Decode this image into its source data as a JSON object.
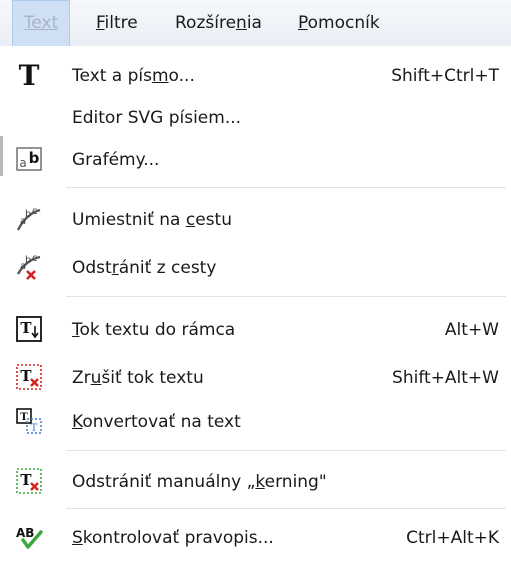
{
  "menubar": {
    "items": [
      {
        "label": "Text"
      },
      {
        "pre": "",
        "ul": "F",
        "post": "iltre"
      },
      {
        "label": "Rozšírenia"
      },
      {
        "pre": "",
        "ul": "P",
        "post": "omocník"
      }
    ]
  },
  "menu": {
    "items": [
      {
        "pre": "Text a pís",
        "ul": "m",
        "post": "o...",
        "shortcut": "Shift+Ctrl+T",
        "icon": "text-font-icon"
      },
      {
        "pre": "Editor SVG písiem...",
        "ul": "",
        "post": "",
        "shortcut": "",
        "icon": ""
      },
      {
        "pre": "Grafémy...",
        "ul": "",
        "post": "",
        "shortcut": "",
        "icon": "glyphs-icon"
      },
      {
        "pre": "Umiestniť na ",
        "ul": "c",
        "post": "estu",
        "shortcut": "",
        "icon": "put-on-path-icon"
      },
      {
        "pre": "Odst",
        "ul": "r",
        "post": "ániť z cesty",
        "shortcut": "",
        "icon": "remove-from-path-icon"
      },
      {
        "pre": "",
        "ul": "T",
        "post": "ok textu do rámca",
        "shortcut": "Alt+W",
        "icon": "flow-into-frame-icon"
      },
      {
        "pre": "Zr",
        "ul": "u",
        "post": "šiť tok textu",
        "shortcut": "Shift+Alt+W",
        "icon": "unflow-icon"
      },
      {
        "pre": "",
        "ul": "K",
        "post": "onvertovať na text",
        "shortcut": "",
        "icon": "convert-to-text-icon"
      },
      {
        "pre": "Odstrániť manuálny „",
        "ul": "k",
        "post": "erning\"",
        "shortcut": "",
        "icon": "remove-kerning-icon"
      },
      {
        "pre": "",
        "ul": "S",
        "post": "kontrolovať pravopis...",
        "shortcut": "Ctrl+Alt+K",
        "icon": "spellcheck-icon"
      }
    ]
  },
  "colors": {
    "menubar_active_bg": "#cfe0f5",
    "dotted_red": "#d62020",
    "check_green": "#3aa83a"
  }
}
